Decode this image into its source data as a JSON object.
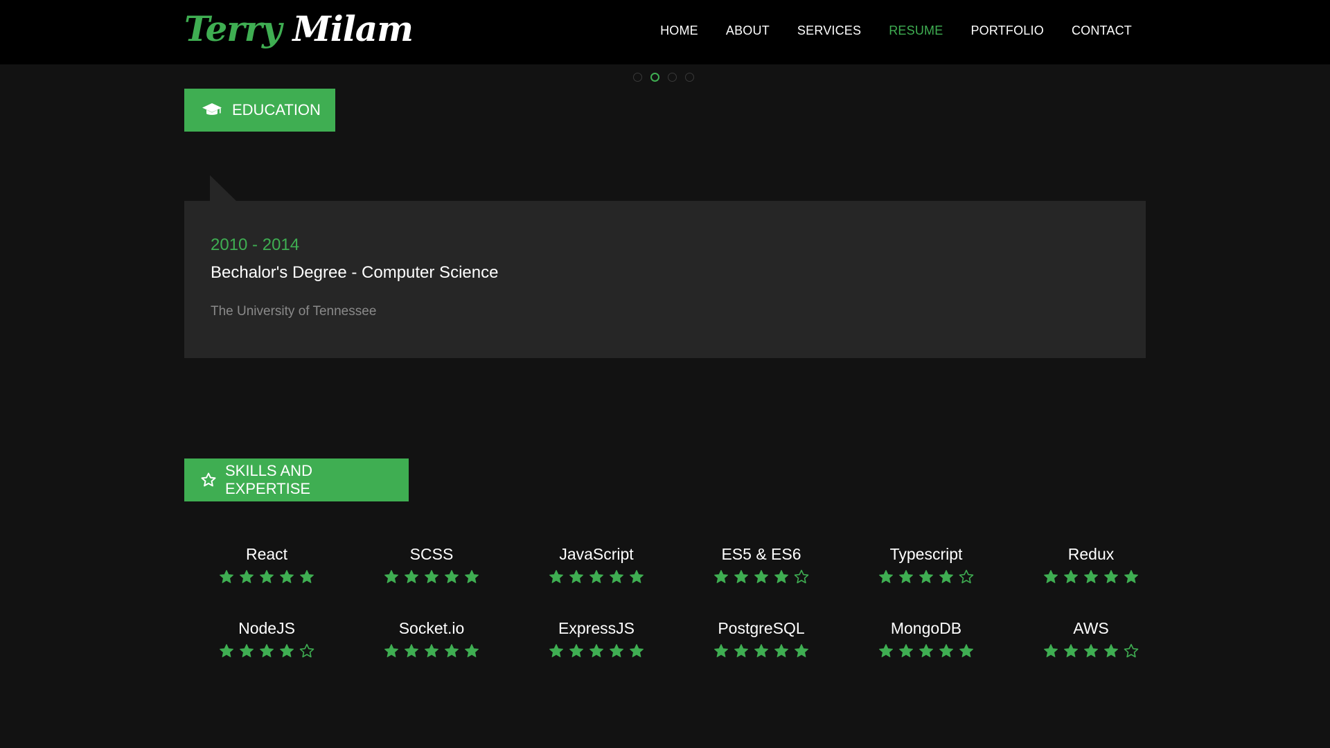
{
  "logo": {
    "first": "Terry",
    "last": "Milam"
  },
  "nav": {
    "items": [
      {
        "label": "HOME",
        "active": false
      },
      {
        "label": "ABOUT",
        "active": false
      },
      {
        "label": "SERVICES",
        "active": false
      },
      {
        "label": "RESUME",
        "active": true
      },
      {
        "label": "PORTFOLIO",
        "active": false
      },
      {
        "label": "CONTACT",
        "active": false
      }
    ]
  },
  "slider": {
    "count": 4,
    "active_index": 1
  },
  "education": {
    "heading": "EDUCATION",
    "icon": "graduation-cap-icon",
    "years": "2010 - 2014",
    "degree": "Bechalor's Degree - Computer Science",
    "school": "The University of Tennessee"
  },
  "skills": {
    "heading": "SKILLS AND EXPERTISE",
    "icon": "star-outline-icon",
    "max_rating": 5,
    "items": [
      {
        "name": "React",
        "rating": 5
      },
      {
        "name": "SCSS",
        "rating": 5
      },
      {
        "name": "JavaScript",
        "rating": 5
      },
      {
        "name": "ES5 & ES6",
        "rating": 4
      },
      {
        "name": "Typescript",
        "rating": 4
      },
      {
        "name": "Redux",
        "rating": 5
      },
      {
        "name": "NodeJS",
        "rating": 4
      },
      {
        "name": "Socket.io",
        "rating": 5
      },
      {
        "name": "ExpressJS",
        "rating": 5
      },
      {
        "name": "PostgreSQL",
        "rating": 5
      },
      {
        "name": "MongoDB",
        "rating": 5
      },
      {
        "name": "AWS",
        "rating": 4
      }
    ]
  },
  "colors": {
    "accent": "#3fae52",
    "background": "#121212",
    "navbar": "#000000",
    "card": "#262626",
    "muted_text": "#8a8a8a"
  }
}
